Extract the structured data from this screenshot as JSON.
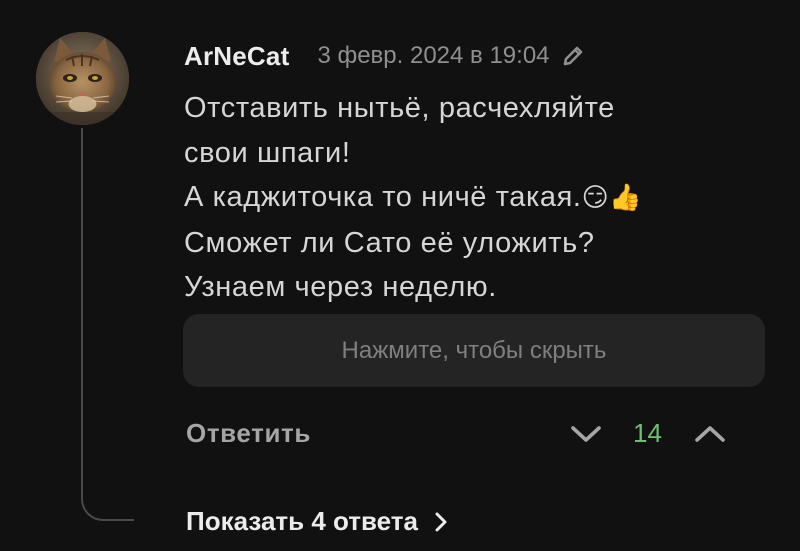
{
  "comment": {
    "author": "ArNeCat",
    "date": "3 февр. 2024 в 19:04",
    "text_lines": [
      "Отставить нытьё, расчехляйте",
      "свои шпаги!",
      "А каджиточка то ничё такая.",
      "Сможет ли Сато её уложить?",
      "Узнаем через неделю."
    ],
    "emojis": [
      "😏",
      "👍"
    ],
    "spoiler_label": "Нажмите, чтобы скрыть",
    "reply_label": "Ответить",
    "score": "14",
    "score_color": "#6fbf73",
    "show_replies_label": "Показать 4 ответа"
  },
  "icons": {
    "edit": "pencil-icon",
    "downvote": "chevron-down-icon",
    "upvote": "chevron-up-icon",
    "expand": "chevron-right-icon",
    "avatar": "cat-avatar"
  }
}
